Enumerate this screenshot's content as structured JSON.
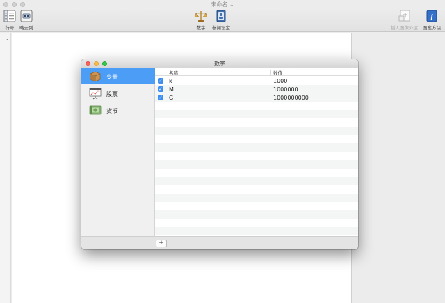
{
  "window": {
    "title": "未命名 ⌄"
  },
  "toolbar": {
    "line_numbers_label": "行号",
    "invisibles_label": "略去列",
    "numbers_label": "数字",
    "references_label": "参阅设定",
    "insert_image_label": "插入图像外运",
    "info_label": "图案方块"
  },
  "document": {
    "line_number": "1"
  },
  "dialog": {
    "title": "数字",
    "sidebar": [
      {
        "label": "变量",
        "icon": "variable-box-icon",
        "selected": true
      },
      {
        "label": "股票",
        "icon": "stock-chart-icon",
        "selected": false
      },
      {
        "label": "货币",
        "icon": "currency-bills-icon",
        "selected": false
      }
    ],
    "table": {
      "headers": {
        "name": "名称",
        "value": "数值"
      },
      "rows": [
        {
          "checked": true,
          "name": "k",
          "value": "1000"
        },
        {
          "checked": true,
          "name": "M",
          "value": "1000000"
        },
        {
          "checked": true,
          "name": "G",
          "value": "1000000000"
        }
      ]
    },
    "add_button": "+"
  },
  "colors": {
    "accent": "#4c9df6",
    "checkbox": "#3e8ef0"
  }
}
